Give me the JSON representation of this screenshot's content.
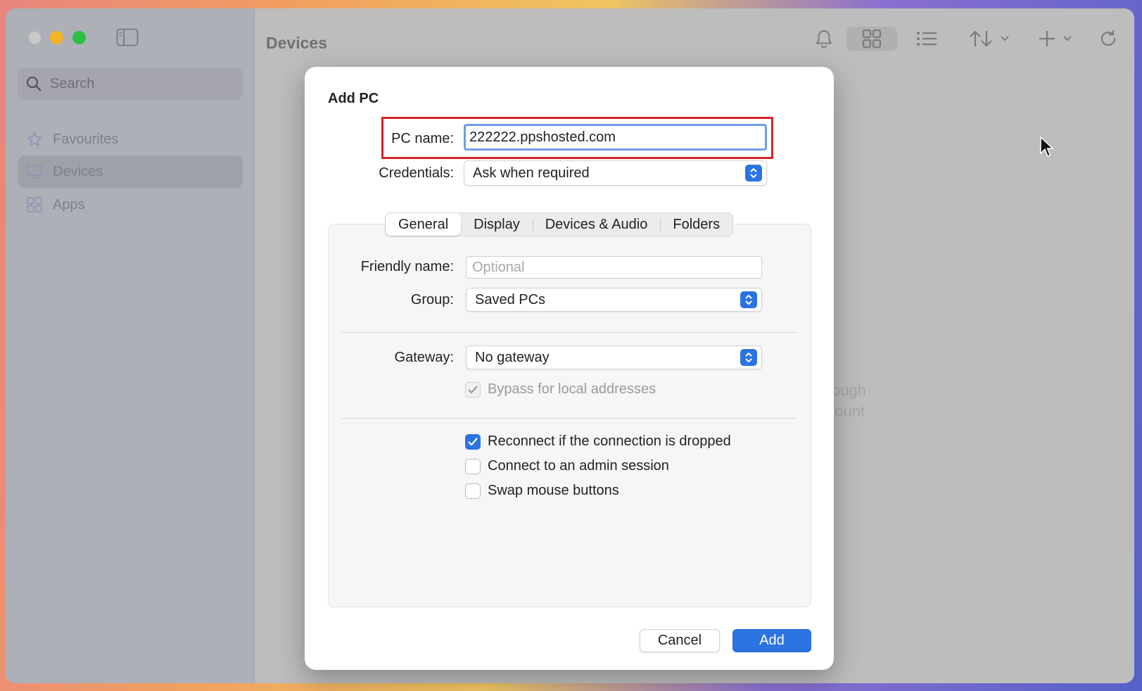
{
  "sidebar": {
    "search_placeholder": "Search",
    "items": [
      {
        "label": "Favourites",
        "icon": "star-icon",
        "active": false
      },
      {
        "label": "Devices",
        "icon": "monitor-icon",
        "active": true
      },
      {
        "label": "Apps",
        "icon": "apps-grid-icon",
        "active": false
      }
    ]
  },
  "main": {
    "title": "Devices",
    "empty_text_line1": "u through",
    "empty_text_line2": "account"
  },
  "toolbar": {
    "icons": [
      "bell-icon",
      "grid-view-icon",
      "list-view-icon",
      "sort-icon",
      "add-icon",
      "refresh-icon"
    ]
  },
  "dialog": {
    "title": "Add PC",
    "pc_name_label": "PC name:",
    "pc_name_value": "222222.ppshosted.com",
    "credentials_label": "Credentials:",
    "credentials_value": "Ask when required",
    "tabs": [
      "General",
      "Display",
      "Devices & Audio",
      "Folders"
    ],
    "active_tab": "General",
    "friendly_name_label": "Friendly name:",
    "friendly_name_placeholder": "Optional",
    "group_label": "Group:",
    "group_value": "Saved PCs",
    "gateway_label": "Gateway:",
    "gateway_value": "No gateway",
    "bypass_label": "Bypass for local addresses",
    "reconnect_label": "Reconnect if the connection is dropped",
    "admin_label": "Connect to an admin session",
    "swap_label": "Swap mouse buttons",
    "cancel_label": "Cancel",
    "add_label": "Add"
  },
  "colors": {
    "accent": "#2c73e2",
    "highlight": "#d6252b"
  }
}
